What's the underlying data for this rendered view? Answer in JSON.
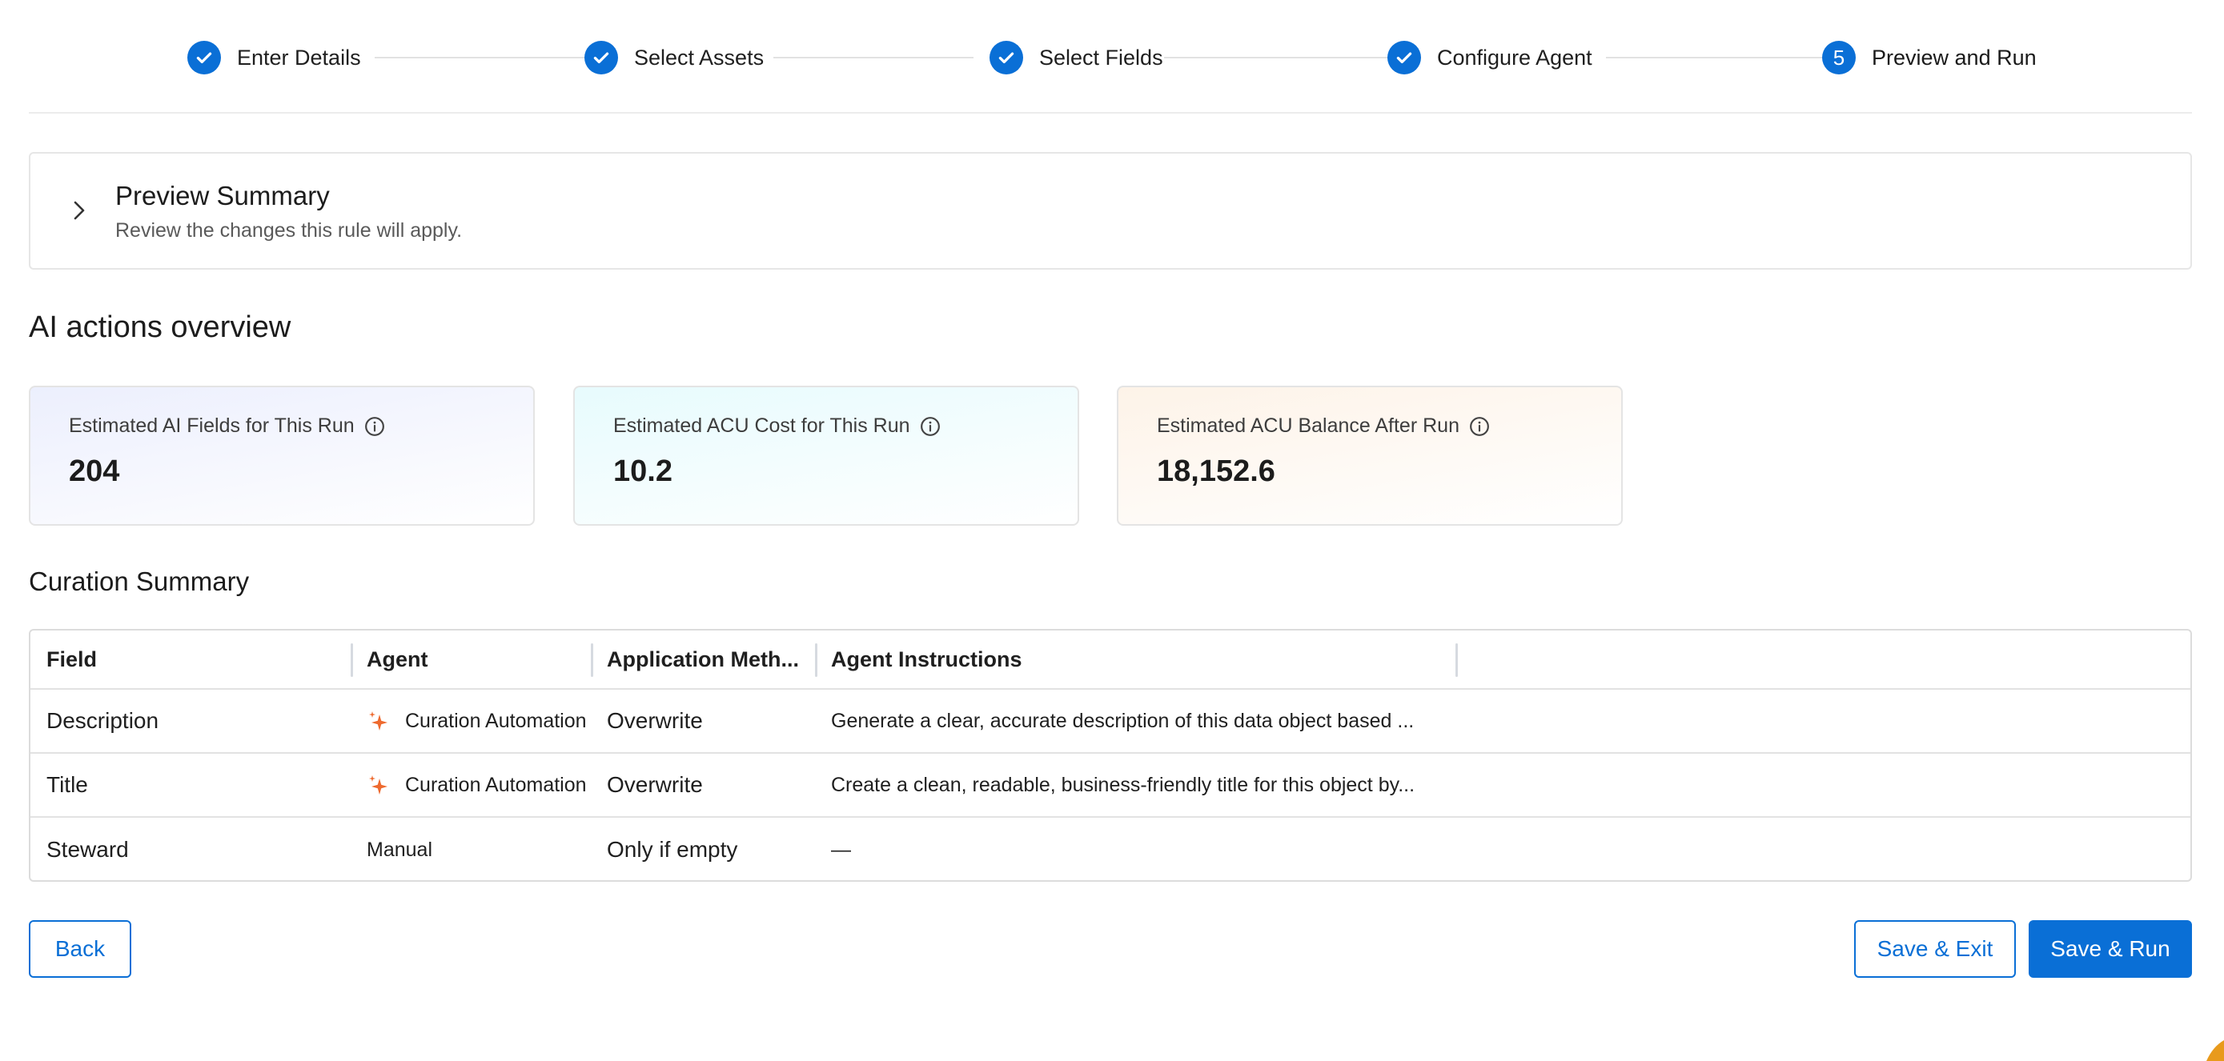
{
  "stepper": {
    "steps": [
      {
        "label": "Enter Details",
        "status": "complete"
      },
      {
        "label": "Select Assets",
        "status": "complete"
      },
      {
        "label": "Select Fields",
        "status": "complete"
      },
      {
        "label": "Configure Agent",
        "status": "complete"
      },
      {
        "label": "Preview and Run",
        "status": "current",
        "number": "5"
      }
    ]
  },
  "preview_summary": {
    "title": "Preview Summary",
    "subtitle": "Review the changes this rule will apply."
  },
  "ai_overview": {
    "title": "AI actions overview",
    "cards": [
      {
        "label": "Estimated AI Fields for This Run",
        "value": "204"
      },
      {
        "label": "Estimated ACU Cost for This Run",
        "value": "10.2"
      },
      {
        "label": "Estimated ACU Balance After Run",
        "value": "18,152.6"
      }
    ]
  },
  "curation_summary": {
    "title": "Curation Summary",
    "columns": [
      "Field",
      "Agent",
      "Application Meth...",
      "Agent Instructions"
    ],
    "rows": [
      {
        "field": "Description",
        "agent": "Curation Automation",
        "method": "Overwrite",
        "instructions": "Generate a clear, accurate description of this data object based ..."
      },
      {
        "field": "Title",
        "agent": "Curation Automation",
        "method": "Overwrite",
        "instructions": "Create a clean, readable, business-friendly title for this object by..."
      },
      {
        "field": "Steward",
        "agent": "Manual",
        "method": "Only if empty",
        "instructions": "—"
      }
    ]
  },
  "footer": {
    "back_label": "Back",
    "save_exit_label": "Save & Exit",
    "save_run_label": "Save & Run"
  },
  "colors": {
    "accent": "#0a6fd6",
    "spark": "#ee6a2f"
  },
  "icons": {
    "step_complete": "check-icon",
    "preview_toggle": "chevron-right-icon",
    "card_info": "info-icon",
    "agent_ai": "sparkle-icon"
  }
}
